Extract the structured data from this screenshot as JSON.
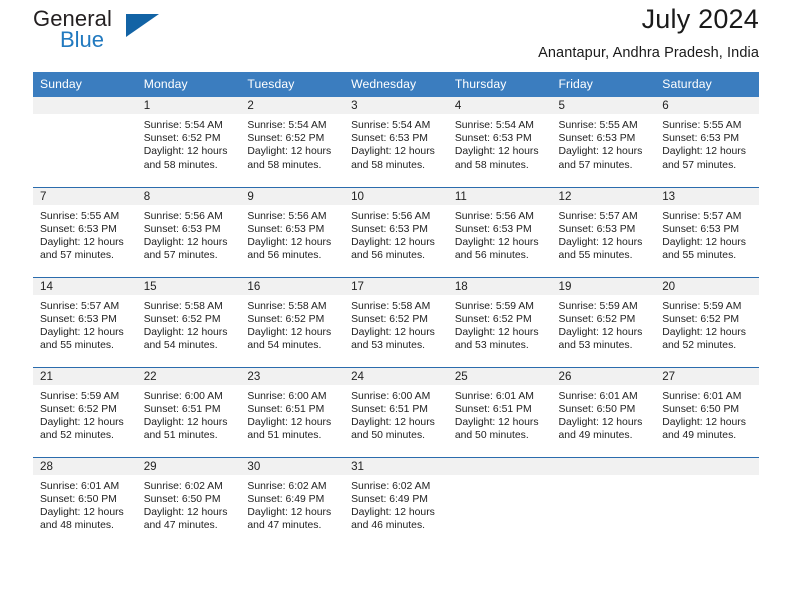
{
  "brand": {
    "name_part1": "General",
    "name_part2": "Blue",
    "triangle_color": "#1263a5",
    "blue_color": "#2179bf"
  },
  "header": {
    "title": "July 2024",
    "subtitle": "Anantapur, Andhra Pradesh, India"
  },
  "theme": {
    "header_bg": "#3b7dbf",
    "row_divider": "#2b6cad",
    "daynum_band": "#f1f1f1"
  },
  "weekday_headers": [
    "Sunday",
    "Monday",
    "Tuesday",
    "Wednesday",
    "Thursday",
    "Friday",
    "Saturday"
  ],
  "weeks": [
    [
      {
        "day": "",
        "empty": true
      },
      {
        "day": "1",
        "sunrise": "Sunrise: 5:54 AM",
        "sunset": "Sunset: 6:52 PM",
        "daylight1": "Daylight: 12 hours",
        "daylight2": "and 58 minutes."
      },
      {
        "day": "2",
        "sunrise": "Sunrise: 5:54 AM",
        "sunset": "Sunset: 6:52 PM",
        "daylight1": "Daylight: 12 hours",
        "daylight2": "and 58 minutes."
      },
      {
        "day": "3",
        "sunrise": "Sunrise: 5:54 AM",
        "sunset": "Sunset: 6:53 PM",
        "daylight1": "Daylight: 12 hours",
        "daylight2": "and 58 minutes."
      },
      {
        "day": "4",
        "sunrise": "Sunrise: 5:54 AM",
        "sunset": "Sunset: 6:53 PM",
        "daylight1": "Daylight: 12 hours",
        "daylight2": "and 58 minutes."
      },
      {
        "day": "5",
        "sunrise": "Sunrise: 5:55 AM",
        "sunset": "Sunset: 6:53 PM",
        "daylight1": "Daylight: 12 hours",
        "daylight2": "and 57 minutes."
      },
      {
        "day": "6",
        "sunrise": "Sunrise: 5:55 AM",
        "sunset": "Sunset: 6:53 PM",
        "daylight1": "Daylight: 12 hours",
        "daylight2": "and 57 minutes."
      }
    ],
    [
      {
        "day": "7",
        "sunrise": "Sunrise: 5:55 AM",
        "sunset": "Sunset: 6:53 PM",
        "daylight1": "Daylight: 12 hours",
        "daylight2": "and 57 minutes."
      },
      {
        "day": "8",
        "sunrise": "Sunrise: 5:56 AM",
        "sunset": "Sunset: 6:53 PM",
        "daylight1": "Daylight: 12 hours",
        "daylight2": "and 57 minutes."
      },
      {
        "day": "9",
        "sunrise": "Sunrise: 5:56 AM",
        "sunset": "Sunset: 6:53 PM",
        "daylight1": "Daylight: 12 hours",
        "daylight2": "and 56 minutes."
      },
      {
        "day": "10",
        "sunrise": "Sunrise: 5:56 AM",
        "sunset": "Sunset: 6:53 PM",
        "daylight1": "Daylight: 12 hours",
        "daylight2": "and 56 minutes."
      },
      {
        "day": "11",
        "sunrise": "Sunrise: 5:56 AM",
        "sunset": "Sunset: 6:53 PM",
        "daylight1": "Daylight: 12 hours",
        "daylight2": "and 56 minutes."
      },
      {
        "day": "12",
        "sunrise": "Sunrise: 5:57 AM",
        "sunset": "Sunset: 6:53 PM",
        "daylight1": "Daylight: 12 hours",
        "daylight2": "and 55 minutes."
      },
      {
        "day": "13",
        "sunrise": "Sunrise: 5:57 AM",
        "sunset": "Sunset: 6:53 PM",
        "daylight1": "Daylight: 12 hours",
        "daylight2": "and 55 minutes."
      }
    ],
    [
      {
        "day": "14",
        "sunrise": "Sunrise: 5:57 AM",
        "sunset": "Sunset: 6:53 PM",
        "daylight1": "Daylight: 12 hours",
        "daylight2": "and 55 minutes."
      },
      {
        "day": "15",
        "sunrise": "Sunrise: 5:58 AM",
        "sunset": "Sunset: 6:52 PM",
        "daylight1": "Daylight: 12 hours",
        "daylight2": "and 54 minutes."
      },
      {
        "day": "16",
        "sunrise": "Sunrise: 5:58 AM",
        "sunset": "Sunset: 6:52 PM",
        "daylight1": "Daylight: 12 hours",
        "daylight2": "and 54 minutes."
      },
      {
        "day": "17",
        "sunrise": "Sunrise: 5:58 AM",
        "sunset": "Sunset: 6:52 PM",
        "daylight1": "Daylight: 12 hours",
        "daylight2": "and 53 minutes."
      },
      {
        "day": "18",
        "sunrise": "Sunrise: 5:59 AM",
        "sunset": "Sunset: 6:52 PM",
        "daylight1": "Daylight: 12 hours",
        "daylight2": "and 53 minutes."
      },
      {
        "day": "19",
        "sunrise": "Sunrise: 5:59 AM",
        "sunset": "Sunset: 6:52 PM",
        "daylight1": "Daylight: 12 hours",
        "daylight2": "and 53 minutes."
      },
      {
        "day": "20",
        "sunrise": "Sunrise: 5:59 AM",
        "sunset": "Sunset: 6:52 PM",
        "daylight1": "Daylight: 12 hours",
        "daylight2": "and 52 minutes."
      }
    ],
    [
      {
        "day": "21",
        "sunrise": "Sunrise: 5:59 AM",
        "sunset": "Sunset: 6:52 PM",
        "daylight1": "Daylight: 12 hours",
        "daylight2": "and 52 minutes."
      },
      {
        "day": "22",
        "sunrise": "Sunrise: 6:00 AM",
        "sunset": "Sunset: 6:51 PM",
        "daylight1": "Daylight: 12 hours",
        "daylight2": "and 51 minutes."
      },
      {
        "day": "23",
        "sunrise": "Sunrise: 6:00 AM",
        "sunset": "Sunset: 6:51 PM",
        "daylight1": "Daylight: 12 hours",
        "daylight2": "and 51 minutes."
      },
      {
        "day": "24",
        "sunrise": "Sunrise: 6:00 AM",
        "sunset": "Sunset: 6:51 PM",
        "daylight1": "Daylight: 12 hours",
        "daylight2": "and 50 minutes."
      },
      {
        "day": "25",
        "sunrise": "Sunrise: 6:01 AM",
        "sunset": "Sunset: 6:51 PM",
        "daylight1": "Daylight: 12 hours",
        "daylight2": "and 50 minutes."
      },
      {
        "day": "26",
        "sunrise": "Sunrise: 6:01 AM",
        "sunset": "Sunset: 6:50 PM",
        "daylight1": "Daylight: 12 hours",
        "daylight2": "and 49 minutes."
      },
      {
        "day": "27",
        "sunrise": "Sunrise: 6:01 AM",
        "sunset": "Sunset: 6:50 PM",
        "daylight1": "Daylight: 12 hours",
        "daylight2": "and 49 minutes."
      }
    ],
    [
      {
        "day": "28",
        "sunrise": "Sunrise: 6:01 AM",
        "sunset": "Sunset: 6:50 PM",
        "daylight1": "Daylight: 12 hours",
        "daylight2": "and 48 minutes."
      },
      {
        "day": "29",
        "sunrise": "Sunrise: 6:02 AM",
        "sunset": "Sunset: 6:50 PM",
        "daylight1": "Daylight: 12 hours",
        "daylight2": "and 47 minutes."
      },
      {
        "day": "30",
        "sunrise": "Sunrise: 6:02 AM",
        "sunset": "Sunset: 6:49 PM",
        "daylight1": "Daylight: 12 hours",
        "daylight2": "and 47 minutes."
      },
      {
        "day": "31",
        "sunrise": "Sunrise: 6:02 AM",
        "sunset": "Sunset: 6:49 PM",
        "daylight1": "Daylight: 12 hours",
        "daylight2": "and 46 minutes."
      },
      {
        "day": "",
        "empty": true
      },
      {
        "day": "",
        "empty": true
      },
      {
        "day": "",
        "empty": true
      }
    ]
  ]
}
